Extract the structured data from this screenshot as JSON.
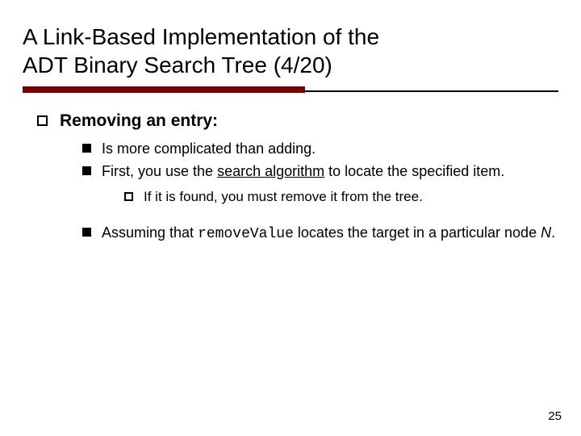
{
  "title_line1": "A Link-Based Implementation of the",
  "title_line2": "ADT Binary Search Tree (4/20)",
  "b1": {
    "text_strong": "Removing an entry",
    "text_tail": ":",
    "s1": "Is more complicated than adding.",
    "s2_a": "First, you use the ",
    "s2_u": "search algorithm",
    "s2_b": " to locate the specified item.",
    "s2_sub1": "If it is found, you must remove it from the tree.",
    "s3_a": "Assuming that ",
    "s3_code": "removeValue",
    "s3_b": " locates the target in a particular node ",
    "s3_i": "N",
    "s3_c": "."
  },
  "page_number": "25"
}
